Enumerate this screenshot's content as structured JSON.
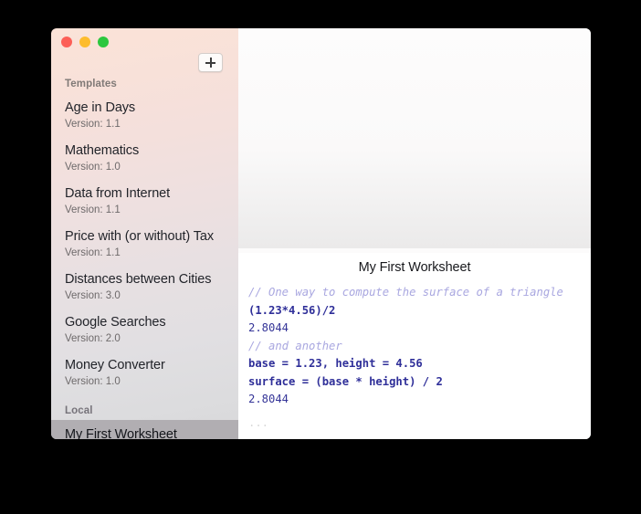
{
  "window": {
    "traffic_lights": [
      {
        "name": "close",
        "color": "#fc5f57"
      },
      {
        "name": "minimize",
        "color": "#fdbc2d"
      },
      {
        "name": "maximize",
        "color": "#2cc73f"
      }
    ]
  },
  "sidebar": {
    "add_button": {
      "icon": "plus-icon",
      "label": "+"
    },
    "sections": [
      {
        "header": "Templates",
        "items": [
          {
            "title": "Age in Days",
            "version": "Version: 1.1",
            "selected": false
          },
          {
            "title": "Mathematics",
            "version": "Version: 1.0",
            "selected": false
          },
          {
            "title": "Data from Internet",
            "version": "Version: 1.1",
            "selected": false
          },
          {
            "title": "Price with (or without) Tax",
            "version": "Version: 1.1",
            "selected": false
          },
          {
            "title": "Distances between Cities",
            "version": "Version: 3.0",
            "selected": false
          },
          {
            "title": "Google Searches",
            "version": "Version: 2.0",
            "selected": false
          },
          {
            "title": "Money Converter",
            "version": "Version: 1.0",
            "selected": false
          }
        ]
      },
      {
        "header": "Local",
        "items": [
          {
            "title": "My First Worksheet",
            "version": "",
            "selected": true
          }
        ]
      }
    ]
  },
  "content": {
    "worksheet_title": "My First Worksheet",
    "code_lines": [
      {
        "kind": "comment",
        "text": "// One way to compute the surface of a triangle"
      },
      {
        "kind": "input",
        "text": "(1.23*4.56)/2"
      },
      {
        "kind": "result",
        "text": "2.8044"
      },
      {
        "kind": "comment",
        "text": "// and another"
      },
      {
        "kind": "input",
        "text": "base = 1.23, height = 4.56"
      },
      {
        "kind": "input",
        "text": "surface = (base * height) / 2"
      },
      {
        "kind": "result",
        "text": "2.8044"
      },
      {
        "kind": "placeholder",
        "text": "..."
      }
    ]
  },
  "colors": {
    "sidebar_top": "#fbe3d8",
    "sidebar_bottom": "#d8d8da",
    "selection": "#b1aeb2",
    "comment": "#a9a7e0",
    "code_input": "#2f2f99",
    "code_result": "#353598",
    "paper": "#ffffff"
  }
}
